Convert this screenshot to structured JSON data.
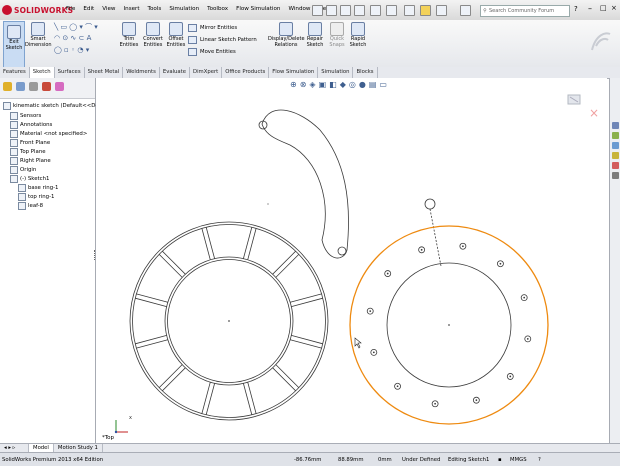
{
  "app": {
    "logo_text": "SOLIDWORKS"
  },
  "menu": [
    "File",
    "Edit",
    "View",
    "Insert",
    "Tools",
    "Simulation",
    "Toolbox",
    "Flow Simulation",
    "Window",
    "Help"
  ],
  "search": {
    "placeholder": "Search Community Forum"
  },
  "commands": {
    "exit_sketch": "Exit Sketch",
    "smart_dimension": "Smart Dimension",
    "trim_entities": "Trim Entities",
    "convert_entities": "Convert Entities",
    "offset_entities": "Offset Entities",
    "mirror_entities": "Mirror Entities",
    "linear_sketch_pattern": "Linear Sketch Pattern",
    "move_entities": "Move Entities",
    "display_delete_relations": "Display/Delete Relations",
    "repair_sketch": "Repair Sketch",
    "quick_snaps": "Quick Snaps",
    "rapid_sketch": "Rapid Sketch"
  },
  "tabs": [
    "Features",
    "Sketch",
    "Surfaces",
    "Sheet Metal",
    "Weldments",
    "Evaluate",
    "DimXpert",
    "Office Products",
    "Flow Simulation",
    "Simulation",
    "Blocks"
  ],
  "active_tab": "Sketch",
  "tree": {
    "root": "kinematic sketch  (Default<<Def",
    "items": [
      "Sensors",
      "Annotations",
      "Material <not specified>",
      "Front Plane",
      "Top Plane",
      "Right Plane",
      "Origin",
      "(-) Sketch1"
    ],
    "children": [
      "base ring-1",
      "top ring-1",
      "leaf-8"
    ]
  },
  "view_label": "*Top",
  "bottom_tabs": [
    "Model",
    "Motion Study 1"
  ],
  "status": {
    "edition": "SolidWorks Premium 2013 x64 Edition",
    "x": "-86.76mm",
    "y": "88.89mm",
    "z": "0mm",
    "defined": "Under Defined",
    "editing": "Editing Sketch1",
    "units": "MMGS"
  },
  "colors": {
    "selected_circle": "#ee8a10",
    "sketch_line": "#3a3a3a",
    "brand": "#c8102e"
  }
}
